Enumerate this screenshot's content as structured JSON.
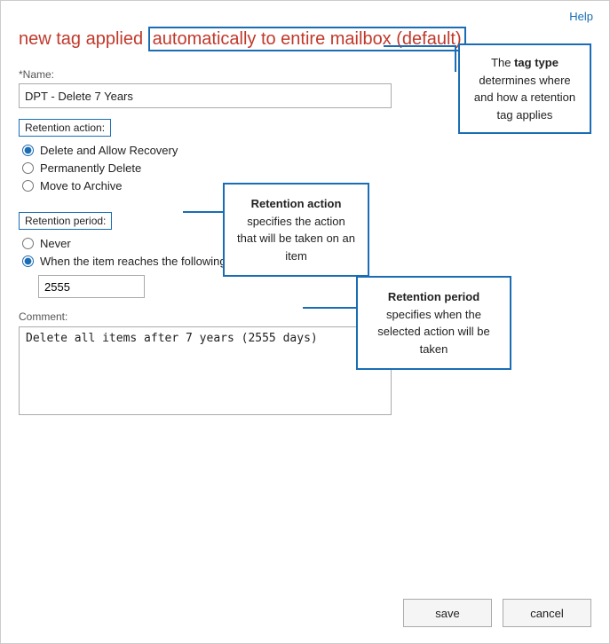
{
  "help": {
    "label": "Help"
  },
  "header": {
    "prefix": "new tag applied",
    "highlighted": "automatically to entire mailbox (default)"
  },
  "form": {
    "name_label": "*Name:",
    "name_value": "DPT - Delete 7 Years",
    "retention_action_label": "Retention action:",
    "actions": [
      {
        "label": "Delete and Allow Recovery",
        "selected": true
      },
      {
        "label": "Permanently Delete",
        "selected": false
      },
      {
        "label": "Move to Archive",
        "selected": false
      }
    ],
    "retention_period_label": "Retention period:",
    "period_options": [
      {
        "label": "Never",
        "selected": false
      },
      {
        "label": "When the item reaches the following age (in days):",
        "selected": true
      }
    ],
    "period_value": "2555",
    "comment_label": "Comment:",
    "comment_value": "Delete all items after 7 years (2555 days)"
  },
  "tooltips": {
    "retention_action": {
      "bold": "Retention action",
      "rest": " specifies the action that will be taken on an item"
    },
    "tag_type": {
      "pre": "The ",
      "bold": "tag type",
      "rest": " determines where and how a retention tag applies"
    },
    "retention_period": {
      "bold": "Retention period",
      "rest": " specifies when the selected action will be taken"
    }
  },
  "buttons": {
    "save": "save",
    "cancel": "cancel"
  }
}
